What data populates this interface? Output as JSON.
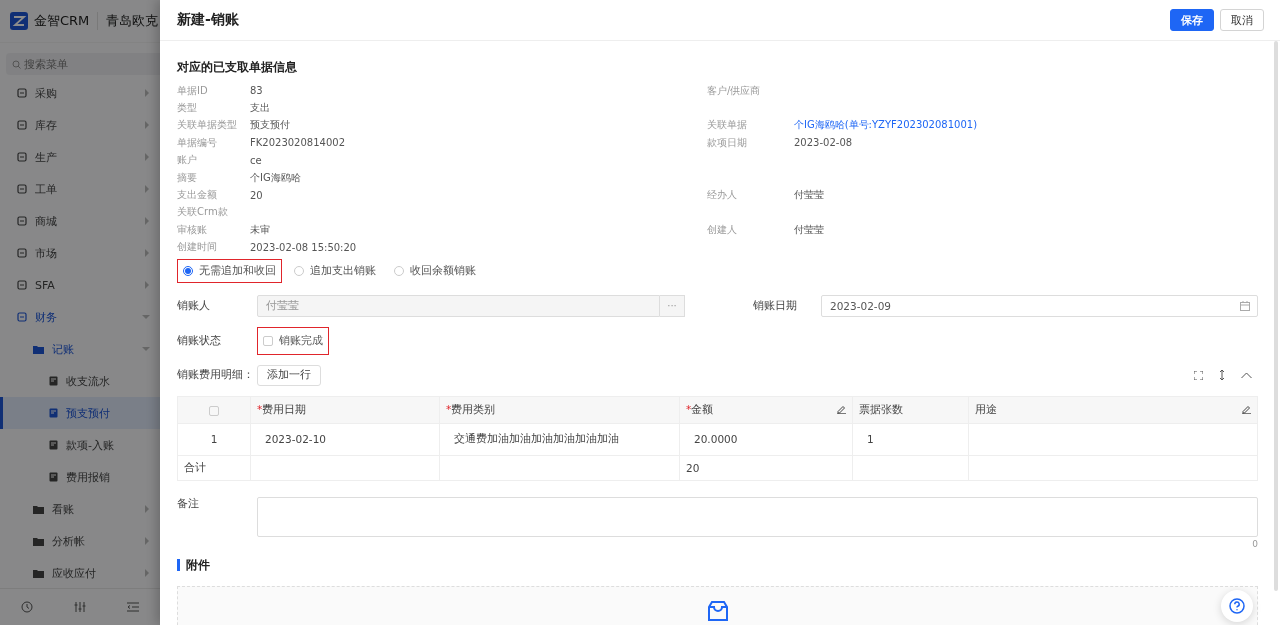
{
  "sidebar": {
    "brand": "金智CRM",
    "company": "青岛欧克",
    "search": {
      "placeholder": "搜索菜单"
    },
    "items": [
      {
        "label": "采购",
        "expanded": false,
        "selected": false
      },
      {
        "label": "库存",
        "expanded": false,
        "selected": false
      },
      {
        "label": "生产",
        "expanded": false,
        "selected": false
      },
      {
        "label": "工单",
        "expanded": false,
        "selected": false
      },
      {
        "label": "商城",
        "expanded": false,
        "selected": false
      },
      {
        "label": "市场",
        "expanded": false,
        "selected": false
      },
      {
        "label": "SFA",
        "expanded": false,
        "selected": false
      },
      {
        "label": "财务",
        "expanded": true,
        "selected": false,
        "children": [
          {
            "label": "记账",
            "expanded": true,
            "selected": false,
            "children": [
              {
                "label": "收支流水",
                "selected": false
              },
              {
                "label": "预支预付",
                "selected": true
              },
              {
                "label": "款项-入账",
                "selected": false
              },
              {
                "label": "费用报销",
                "selected": false
              }
            ]
          },
          {
            "label": "看账",
            "expanded": false,
            "selected": false
          },
          {
            "label": "分析帐",
            "expanded": false,
            "selected": false
          },
          {
            "label": "应收应付",
            "expanded": false,
            "selected": false
          }
        ]
      }
    ]
  },
  "drawer": {
    "title": "新建-销账",
    "buttons": [
      {
        "label": "保存",
        "kind": "primary"
      },
      {
        "label": "取消",
        "kind": "default"
      }
    ],
    "source": {
      "title": "对应的已支取单据信息",
      "rows": [
        {
          "label": "单据ID",
          "value": "83",
          "right_label": "客户/供应商"
        },
        {
          "label": "类型",
          "value": "支出"
        },
        {
          "label": "关联单据类型",
          "value": "预支预付",
          "right_label": "关联单据",
          "right_value": "个IG海鸥哈(单号:YZYF202302081001)",
          "right_link": true
        },
        {
          "label": "单据编号",
          "value": "FK2023020814002",
          "right_label": "款项日期",
          "right_value": "2023-02-08",
          "right_link": false
        },
        {
          "label": "账户",
          "value": "ce"
        },
        {
          "label": "摘要",
          "value": "个IG海鸥哈"
        },
        {
          "label": "支出金额",
          "value": "20",
          "right_label": "经办人",
          "right_value": "付莹莹",
          "right_link": false
        },
        {
          "label": "关联Crm款"
        },
        {
          "label": "审核账",
          "value": "未审",
          "right_label": "创建人",
          "right_value": "付莹莹",
          "right_link": false
        },
        {
          "label": "创建时间",
          "value": "2023-02-08 15:50:20"
        }
      ]
    },
    "mode_options": [
      {
        "label": "无需追加和收回",
        "selected": true,
        "highlighted": true
      },
      {
        "label": "追加支出销账",
        "selected": false,
        "highlighted": false
      },
      {
        "label": "收回余额销账",
        "selected": false,
        "highlighted": false
      }
    ],
    "writer": {
      "label": "销账人",
      "value": "付莹莹",
      "disabled": true,
      "picker_button": "···"
    },
    "date": {
      "label": "销账日期",
      "value": "2023-02-09"
    },
    "status": {
      "label": "销账状态",
      "option": "销账完成",
      "checked": false,
      "highlighted": true
    },
    "details": {
      "label": "销账费用明细：",
      "add_button": "添加一行",
      "select_all": {
        "checked": false
      },
      "columns": [
        {
          "label": "费用日期",
          "required_mark": "*",
          "editable": false
        },
        {
          "label": "费用类别",
          "required_mark": "*",
          "editable": false
        },
        {
          "label": "金额",
          "required_mark": "*",
          "editable": true
        },
        {
          "label": "票据张数",
          "editable": false
        },
        {
          "label": "用途",
          "editable": true
        }
      ],
      "rows": [
        {
          "index": "1",
          "expense_date": "2023-02-10",
          "category": "交通费加油加油加油加油加油加油",
          "amount": "20.0000",
          "invoices": "1"
        }
      ],
      "total": {
        "label": "合计",
        "amount": "20"
      }
    },
    "remark": {
      "label": "备注",
      "count": "0"
    },
    "attachments": {
      "title": "附件"
    }
  }
}
